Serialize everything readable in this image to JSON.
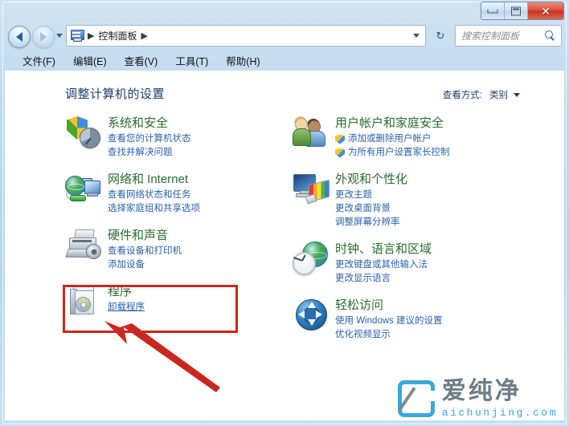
{
  "window": {
    "controls": {
      "minimize": "最小化",
      "maximize": "最大化",
      "close": "关闭"
    }
  },
  "navbar": {
    "back": "后退",
    "forward": "前进",
    "recent_pages": "最近浏览的页面",
    "breadcrumb": [
      "控制面板"
    ],
    "breadcrumb_separator": "▶",
    "refresh": "刷新",
    "search": {
      "placeholder": "搜索控制面板",
      "value": ""
    }
  },
  "menubar": {
    "items": [
      {
        "label": "文件(F)"
      },
      {
        "label": "编辑(E)"
      },
      {
        "label": "查看(V)"
      },
      {
        "label": "工具(T)"
      },
      {
        "label": "帮助(H)"
      }
    ]
  },
  "content": {
    "page_title": "调整计算机的设置",
    "view_by": {
      "label": "查看方式:",
      "value": "类别"
    },
    "left_categories": [
      {
        "icon": "shield-pie-icon",
        "title": "系统和安全",
        "links": [
          {
            "text": "查看您的计算机状态",
            "shield": false,
            "underline": false
          },
          {
            "text": "查找并解决问题",
            "shield": false,
            "underline": false
          }
        ]
      },
      {
        "icon": "globe-monitors-icon",
        "title": "网络和 Internet",
        "links": [
          {
            "text": "查看网络状态和任务",
            "shield": false,
            "underline": false
          },
          {
            "text": "选择家庭组和共享选项",
            "shield": false,
            "underline": false
          }
        ]
      },
      {
        "icon": "printer-speaker-icon",
        "title": "硬件和声音",
        "links": [
          {
            "text": "查看设备和打印机",
            "shield": false,
            "underline": false
          },
          {
            "text": "添加设备",
            "shield": false,
            "underline": false
          }
        ]
      },
      {
        "icon": "program-package-icon",
        "title": "程序",
        "links": [
          {
            "text": "卸载程序",
            "shield": false,
            "underline": true
          }
        ]
      }
    ],
    "right_categories": [
      {
        "icon": "two-people-icon",
        "title": "用户帐户和家庭安全",
        "links": [
          {
            "text": "添加或删除用户帐户",
            "shield": true,
            "underline": false
          },
          {
            "text": "为所有用户设置家长控制",
            "shield": true,
            "underline": false
          }
        ]
      },
      {
        "icon": "monitor-palette-icon",
        "title": "外观和个性化",
        "links": [
          {
            "text": "更改主题",
            "shield": false,
            "underline": false
          },
          {
            "text": "更改桌面背景",
            "shield": false,
            "underline": false
          },
          {
            "text": "调整屏幕分辨率",
            "shield": false,
            "underline": false
          }
        ]
      },
      {
        "icon": "globe-clock-icon",
        "title": "时钟、语言和区域",
        "links": [
          {
            "text": "更改键盘或其他输入法",
            "shield": false,
            "underline": false
          },
          {
            "text": "更改显示语言",
            "shield": false,
            "underline": false
          }
        ]
      },
      {
        "icon": "ease-of-access-icon",
        "title": "轻松访问",
        "links": [
          {
            "text": "使用 Windows 建议的设置",
            "shield": false,
            "underline": false
          },
          {
            "text": "优化视频显示",
            "shield": false,
            "underline": false
          }
        ]
      }
    ]
  },
  "annotation": {
    "highlight_target": "程序",
    "arrow_target": "卸载程序",
    "color": "#c9281e"
  },
  "watermark": {
    "brand_cn": "爱纯净",
    "brand_en": "aichunjing.com",
    "logo_color": "#3aa7dd"
  },
  "colors": {
    "category_title": "#2a6b2f",
    "category_link": "#2a62a8",
    "page_title": "#1b3f66",
    "annotation_red": "#c9281e",
    "frame_glass": "#bcd8ef"
  }
}
